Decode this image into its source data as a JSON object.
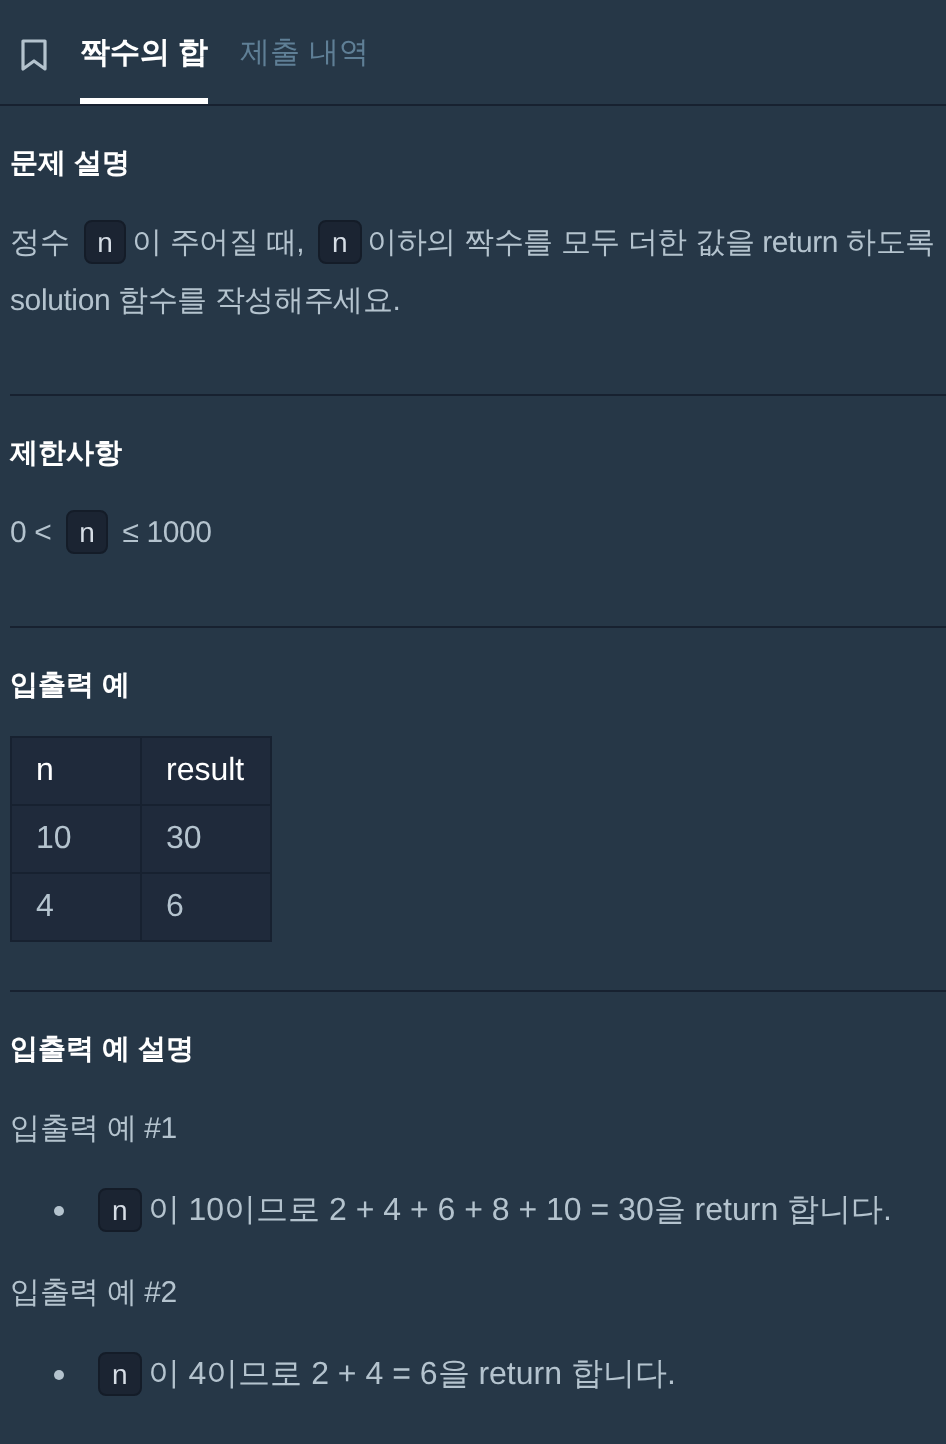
{
  "tabs": [
    {
      "label": "짝수의 합",
      "selected": true
    },
    {
      "label": "제출 내역",
      "selected": false
    }
  ],
  "sections": [
    {
      "title": "문제 설명",
      "blocks": [
        {
          "kind": "paragraph",
          "segments": [
            {
              "kind": "text",
              "text": "정수 "
            },
            {
              "kind": "code",
              "text": "n"
            },
            {
              "kind": "text",
              "text": "이 주어질 때, "
            },
            {
              "kind": "code",
              "text": "n"
            },
            {
              "kind": "text",
              "text": "이하의 짝수를 모두 더한 값을 return 하도록"
            },
            {
              "kind": "break"
            },
            {
              "kind": "text",
              "text": "solution 함수를 작성해주세요."
            }
          ]
        }
      ]
    },
    {
      "title": "제한사항",
      "blocks": [
        {
          "kind": "paragraph",
          "segments": [
            {
              "kind": "text",
              "text": "0 < "
            },
            {
              "kind": "code",
              "text": "n"
            },
            {
              "kind": "text",
              "text": " ≤ 1000"
            }
          ]
        }
      ]
    },
    {
      "title": "입출력 예",
      "blocks": [
        {
          "kind": "table",
          "columns": [
            "n",
            "result"
          ],
          "rows": [
            [
              "10",
              "30"
            ],
            [
              "4",
              "6"
            ]
          ]
        }
      ]
    },
    {
      "title": "입출력 예 설명",
      "blocks": [
        {
          "kind": "paragraph",
          "segments": [
            {
              "kind": "text",
              "text": "입출력 예 #1"
            }
          ]
        },
        {
          "kind": "bullet",
          "segments": [
            {
              "kind": "code",
              "text": "n"
            },
            {
              "kind": "text",
              "text": "이 10이므로 2 + 4 + 6 + 8 + 10 = 30을 return 합니다."
            }
          ]
        },
        {
          "kind": "paragraph",
          "segments": [
            {
              "kind": "text",
              "text": "입출력 예 #2"
            }
          ]
        },
        {
          "kind": "bullet",
          "segments": [
            {
              "kind": "code",
              "text": "n"
            },
            {
              "kind": "text",
              "text": "이 4이므로 2 + 4 = 6을 return 합니다."
            }
          ]
        }
      ]
    }
  ]
}
